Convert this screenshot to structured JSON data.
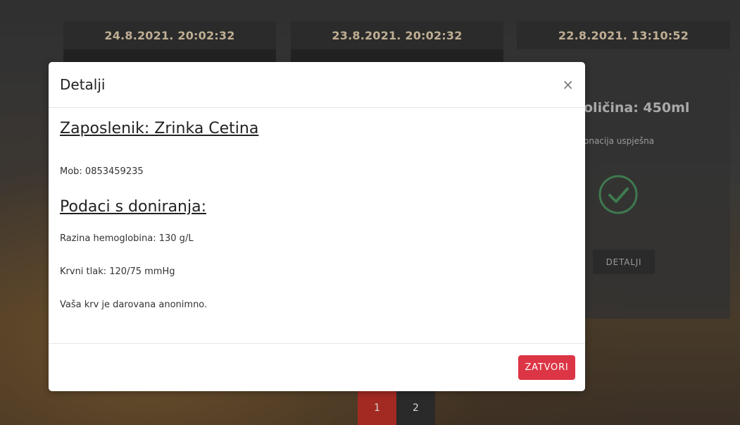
{
  "cards": [
    {
      "date": "24.8.2021. 20:02:32"
    },
    {
      "date": "23.8.2021. 20:02:32"
    },
    {
      "date": "22.8.2021. 13:10:52",
      "quantity_partial": "oličina: 450ml",
      "status_partial": "onacija uspješna",
      "details_label": "DETALJI"
    }
  ],
  "pagination": {
    "pages": [
      "1",
      "2"
    ],
    "active": "1"
  },
  "modal": {
    "title": "Detalji",
    "close_icon": "×",
    "employee_heading": "Zaposlenik: Zrinka Cetina",
    "mobile": "Mob: 0853459235",
    "data_heading": "Podaci s doniranja:",
    "hemoglobin": "Razina hemoglobina: 130 g/L",
    "blood_pressure": "Krvni tlak: 120/75 mmHg",
    "anonymous_note": "Vaša krv je darovana anonimno.",
    "close_button": "ZATVORI"
  },
  "colors": {
    "close_button": "#dc3545",
    "active_page": "#a32a22",
    "check_icon": "#3f7a4f",
    "card_header_text": "#bfae93"
  }
}
